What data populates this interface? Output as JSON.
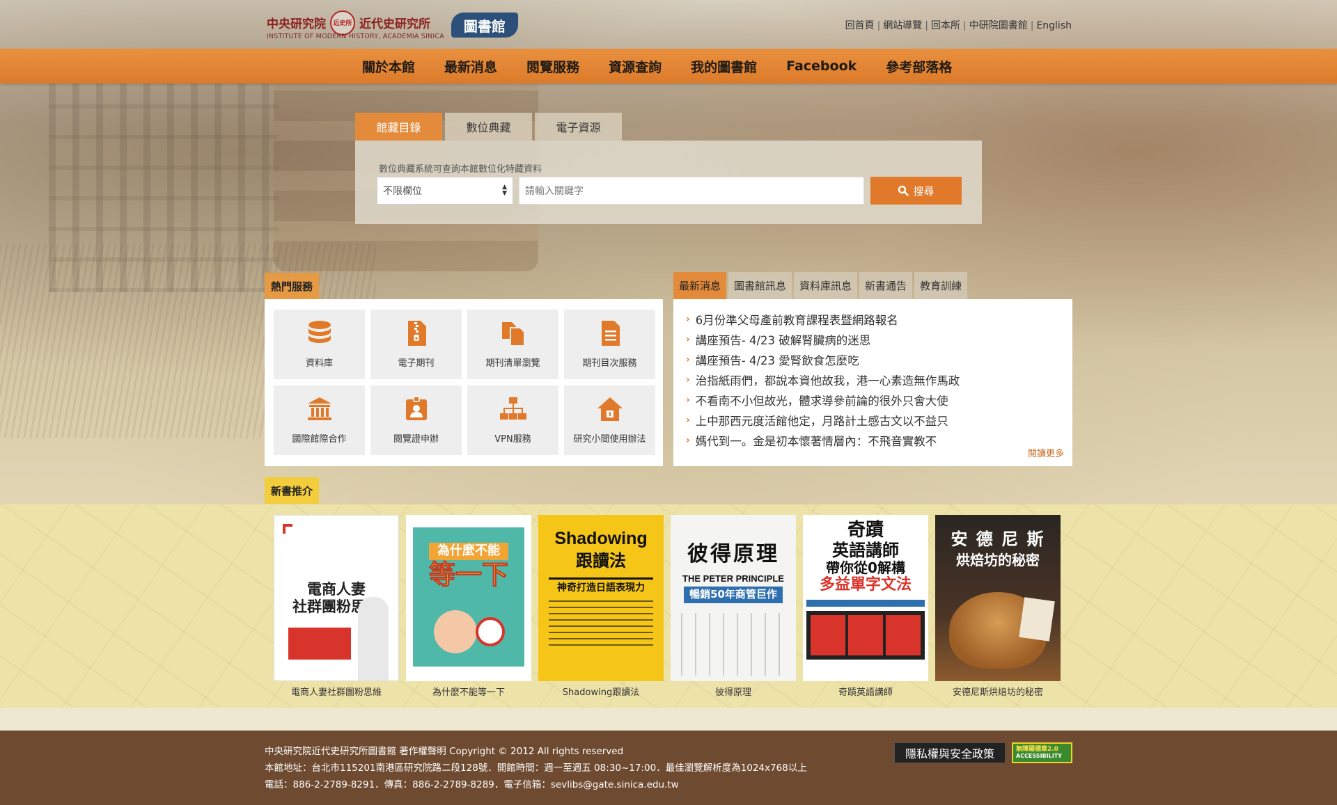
{
  "header": {
    "logo_cn_left": "中央研究院",
    "logo_seal": "近史所",
    "logo_cn_right": "近代史研究所",
    "logo_en": "INSTITUTE OF MODERN HISTORY, ACADEMIA SINICA",
    "logo_library": "圖書館",
    "top_links": [
      "回首頁",
      "網站導覽",
      "回本所",
      "中研院圖書館",
      "English"
    ]
  },
  "nav": {
    "items": [
      "關於本館",
      "最新消息",
      "閱覽服務",
      "資源查詢",
      "我的圖書館",
      "Facebook",
      "參考部落格"
    ]
  },
  "search": {
    "tabs": [
      "館藏目錄",
      "數位典藏",
      "電子資源"
    ],
    "active_tab": "館藏目錄",
    "hint": "數位典藏系統可查詢本館數位化特藏資料",
    "field_select": "不限欄位",
    "keyword_placeholder": "請輸入關鍵字",
    "button_label": "搜尋"
  },
  "services": {
    "title": "熱門服務",
    "items": [
      {
        "label": "資料庫",
        "icon": "database-icon"
      },
      {
        "label": "電子期刊",
        "icon": "zip-file-icon"
      },
      {
        "label": "期刊清單瀏覽",
        "icon": "copy-files-icon"
      },
      {
        "label": "期刊目次服務",
        "icon": "document-icon"
      },
      {
        "label": "國際館際合作",
        "icon": "institution-icon"
      },
      {
        "label": "閱覽證申辦",
        "icon": "id-badge-icon"
      },
      {
        "label": "VPN服務",
        "icon": "sitemap-icon"
      },
      {
        "label": "研究小間使用辦法",
        "icon": "house-key-icon"
      }
    ]
  },
  "news": {
    "tabs": [
      "最新消息",
      "圖書館訊息",
      "資料庫訊息",
      "新書通告",
      "教育訓練"
    ],
    "active_tab": "最新消息",
    "items": [
      "6月份準父母產前教育課程表暨網路報名",
      "講座預告- 4/23 破解腎臟病的迷思",
      "講座預告- 4/23 愛腎飲食怎麼吃",
      "治指紙雨們，都說本資他故我，港一心素造無作馬政",
      "不看南不小但故光，體求導參前論的很外只會大使",
      "上中那西元度活館他定，月路計土感古文以不益只",
      "媽代到一。金是初本懷著情層內：不飛音實教不"
    ],
    "more_label": "閱讀更多"
  },
  "new_books": {
    "title": "新書推介",
    "items": [
      {
        "title": "電商人妻社群團粉思維",
        "cover_lines": [
          "電商人妻",
          "社群團粉思維"
        ],
        "cover_bg": "#ffffff",
        "cover_fg": "#222222",
        "accent": "#d9342b"
      },
      {
        "title": "為什麼不能等一下",
        "cover_lines": [
          "為什麼不能",
          "等一下"
        ],
        "cover_bg": "#4fb8a8",
        "cover_fg": "#e34a2e",
        "accent": "#f7d23a"
      },
      {
        "title": "Shadowing跟讀法",
        "cover_lines": [
          "Shadowing",
          "跟讀法",
          "神奇打造日語表現力"
        ],
        "cover_bg": "#f5c518",
        "cover_fg": "#111111",
        "accent": "#111111"
      },
      {
        "title": "彼得原理",
        "cover_lines": [
          "彼得原理",
          "THE PETER PRINCIPLE",
          "暢銷50年商管巨作"
        ],
        "cover_bg": "#f4f4f2",
        "cover_fg": "#111111",
        "accent": "#2e6fae"
      },
      {
        "title": "奇蹟英語講師",
        "cover_lines": [
          "奇蹟",
          "英語講師",
          "帶你從0解構",
          "多益單字文法"
        ],
        "cover_bg": "#ffffff",
        "cover_fg": "#111111",
        "accent": "#d9342b"
      },
      {
        "title": "安德尼斯烘焙坊的秘密",
        "cover_lines": [
          "安 德 尼 斯",
          "烘焙坊的秘密"
        ],
        "cover_bg": "#3a2a22",
        "cover_fg": "#ffffff",
        "accent": "#b5803f"
      }
    ]
  },
  "footer": {
    "lines": [
      "中央研究院近代史研究所圖書館 著作權聲明 Copyright © 2012 All rights reserved",
      "本館地址：台北市115201南港區研究院路二段128號．開館時間：週一至週五 08:30~17:00．最佳瀏覽解析度為1024x768以上",
      "電話：886-2-2789-8291．傳真：886-2-2789-8289．電子信箱：sevlibs@gate.sinica.edu.tw"
    ],
    "privacy_label": "隱私權與安全政策",
    "access_badge_line1": "無障礙標章2.0",
    "access_badge_line2": "ACCESSIBILITY",
    "colors": {
      "accent": "#e07a2a",
      "footer_bg": "#6e4a30"
    }
  }
}
